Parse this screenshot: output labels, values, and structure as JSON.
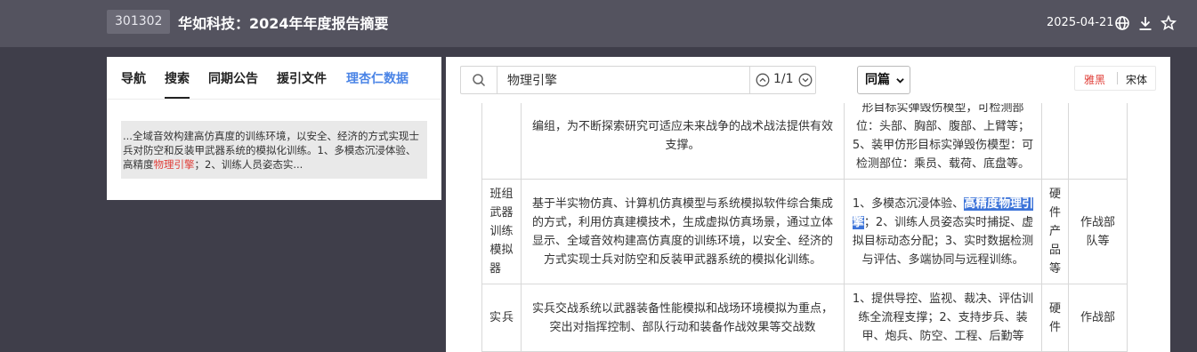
{
  "header": {
    "stock_code": "301302",
    "title": "华如科技：2024年年度报告摘要",
    "date": "2025-04-21",
    "icons": [
      "globe-icon",
      "download-icon",
      "star-icon"
    ]
  },
  "sidebar": {
    "tabs": [
      {
        "label": "导航"
      },
      {
        "label": "搜索"
      },
      {
        "label": "同期公告"
      },
      {
        "label": "援引文件"
      },
      {
        "label": "理杏仁数据"
      }
    ],
    "active_tab": "搜索",
    "result": {
      "before": "...全域音效构建高仿真度的训练环境，以安全、经济的方式实现士兵对防空和反装甲武器系统的模拟化训练。1、多模态沉浸体验、高精度",
      "highlight": "物理引擎",
      "after": "；2、训练人员姿态实..."
    }
  },
  "search": {
    "value": "物理引擎",
    "match_count": "1/1",
    "scope": "同篇"
  },
  "font_switch": {
    "option_active": "雅黑",
    "option_other": "宋体"
  },
  "table": {
    "row1": {
      "desc": "编组，为不断探索研究可适应未来战争的战术战法提供有效支撑。",
      "features": "形目标实弹毁伤模型，可检测部位：头部、胸部、腹部、上臂等；5、装甲仿形目标实弹毁伤模型：可检测部位：乘员、载荷、底盘等。"
    },
    "row2": {
      "name": "班组武器训练模拟器",
      "desc": "基于半实物仿真、计算机仿真模型与系统模拟软件综合集成的方式，利用仿真建模技术，生成虚拟仿真场景，通过立体显示、全域音效构建高仿真度的训练环境，以安全、经济的方式实现士兵对防空和反装甲武器系统的模拟化训练。",
      "features_before": "1、多模态沉浸体验、",
      "features_highlight": "高精度物理引擎",
      "features_after": "；2、训练人员姿态实时捕捉、虚拟目标动态分配；3、实时数据检测与评估、多端协同与远程训练。",
      "type": "硬件产品等",
      "users": "作战部队等"
    },
    "row3": {
      "name": "实兵",
      "desc": "实兵交战系统以武器装备性能模拟和战场环境模拟为重点，突出对指挥控制、部队行动和装备作战效果等交战数",
      "features": "1、提供导控、监视、裁决、评估训练全流程支撑；2、支持步兵、装甲、炮兵、防空、工程、后勤等",
      "type": "硬件",
      "users": "作战部"
    }
  }
}
